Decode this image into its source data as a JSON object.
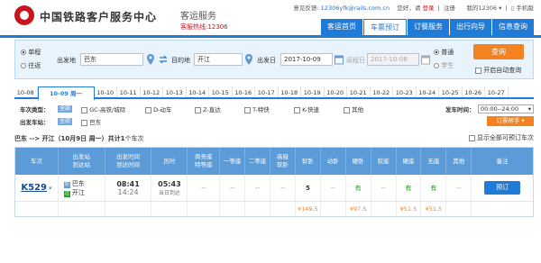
{
  "header": {
    "logo_text": "中国铁路客户服务中心",
    "service_title": "客运服务",
    "hotline": "客服热线:12306",
    "feedback_label": "意见反馈:",
    "feedback_email": "12306yfk@rails.com.cn",
    "greeting": "您好，请",
    "login": "登录",
    "register": "注册",
    "my_account": "我的12306",
    "mobile": "手机版"
  },
  "nav": {
    "items": [
      "客运首页",
      "车票预订",
      "订餐服务",
      "出行向导",
      "信息查询"
    ],
    "active": "车票预订"
  },
  "search": {
    "trip_type": [
      "单程",
      "往返"
    ],
    "from_label": "出发地",
    "from_value": "巴东",
    "to_label": "目的地",
    "to_value": "开江",
    "depart_label": "出发日",
    "depart_value": "2017-10-09",
    "return_label": "返程日",
    "return_value": "2017-10-08",
    "passenger_types": [
      "普通",
      "学生"
    ],
    "query_button": "查询",
    "auto_query": "开启自动查询"
  },
  "dates": {
    "items": [
      "10-08",
      "10-09 周一",
      "10-10",
      "10-11",
      "10-12",
      "10-13",
      "10-14",
      "10-15",
      "10-16",
      "10-17",
      "10-18",
      "10-19",
      "10-20",
      "10-21",
      "10-22",
      "10-23",
      "10-24",
      "10-25",
      "10-26",
      "10-27"
    ],
    "active_index": 1
  },
  "filters": {
    "type_label": "车次类型：",
    "all": "全部",
    "types": [
      "GC-高铁/城际",
      "D-动车",
      "Z-直达",
      "T-特快",
      "K-快速",
      "其他"
    ],
    "station_label": "出发车站：",
    "stations": [
      "巴东"
    ],
    "time_label": "发车时间：",
    "time_value": "00:00--24:00",
    "order_helper": "订票帮手"
  },
  "summary": {
    "route": "巴东 --> 开江（10月9日 周一）共计",
    "count": "1",
    "suffix": "个车次",
    "show_all": "显示全部可预订车次"
  },
  "table": {
    "headers": [
      "车次",
      "出发站\n到达站",
      "出发时间\n到达时间",
      "历时",
      "商务座\n特等座",
      "一等座",
      "二等座",
      "高级\n软卧",
      "软卧",
      "动卧",
      "硬卧",
      "软座",
      "硬座",
      "无座",
      "其他",
      "备注"
    ],
    "rows": [
      {
        "train": "K529",
        "from_station": "巴东",
        "to_station": "开江",
        "depart_time": "08:41",
        "arrive_time": "14:24",
        "duration": "05:43",
        "arrive_day": "当日到达",
        "seats": [
          "--",
          "--",
          "--",
          "--",
          "5",
          "--",
          "有",
          "--",
          "有",
          "有",
          "--"
        ],
        "prices": [
          "",
          "",
          "",
          "",
          "¥149.5",
          "",
          "¥97.5",
          "",
          "¥51.5",
          "¥51.5",
          ""
        ],
        "action": "预订"
      }
    ]
  },
  "colors": {
    "brand_blue": "#1f7bd6",
    "header_blue": "#5b9bd8",
    "orange": "#f58220",
    "red": "#c7161e",
    "green": "#2a9d2a"
  }
}
